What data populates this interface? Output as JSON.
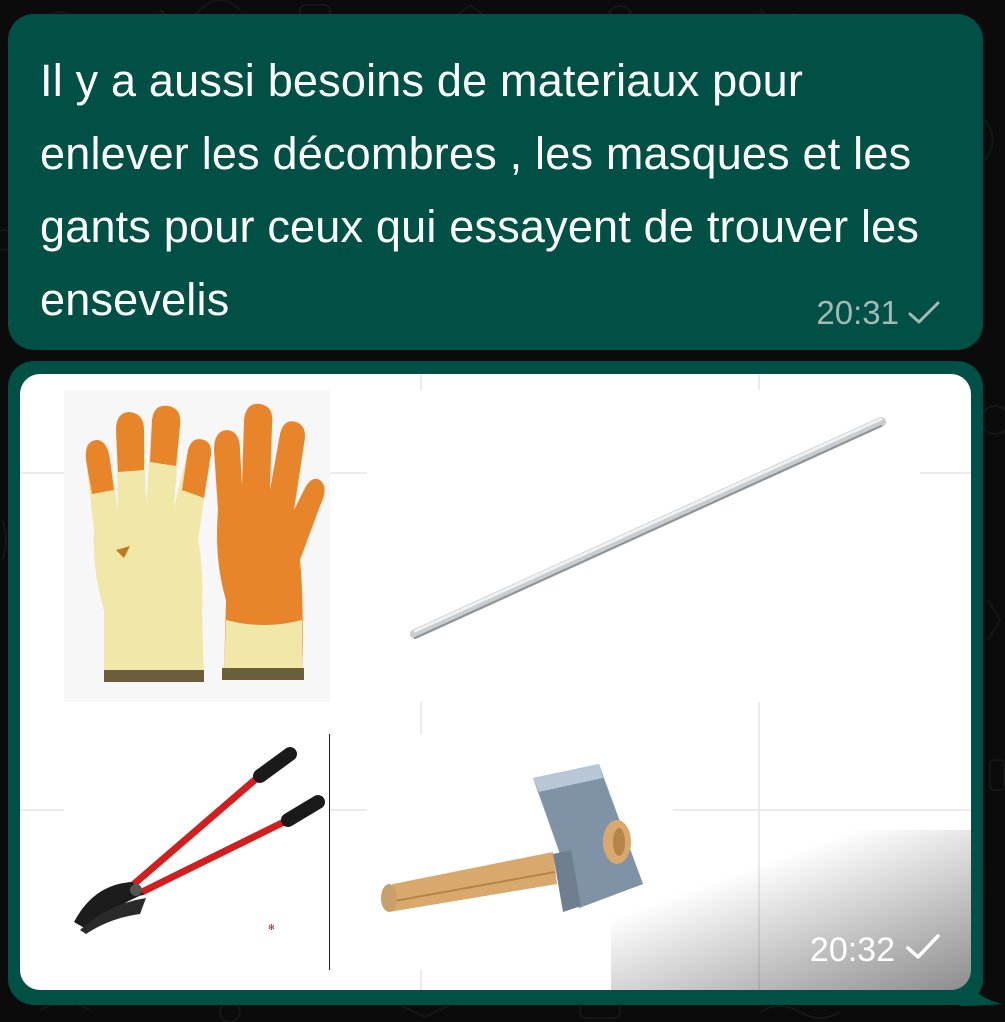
{
  "conversation": {
    "messages": [
      {
        "text": "Il y a aussi besoins de materiaux pour enlever les décombres , les masques et les gants pour ceux qui essayent de trouver les ensevelis",
        "time": "20:31",
        "status_icon": "single-check-icon"
      },
      {
        "type": "image",
        "time": "20:32",
        "status_icon": "single-check-icon",
        "images": [
          {
            "name": "gloves-image",
            "icon": "orange-work-gloves"
          },
          {
            "name": "crowbar-image",
            "icon": "steel-bar"
          },
          {
            "name": "bolt-cutter-image",
            "icon": "red-bolt-cutter"
          },
          {
            "name": "sledgehammer-image",
            "icon": "sledgehammer"
          }
        ]
      }
    ]
  },
  "colors": {
    "outgoing_bubble": "#005046",
    "background": "#0b0b0b",
    "meta_text": "#a3b9b4"
  }
}
